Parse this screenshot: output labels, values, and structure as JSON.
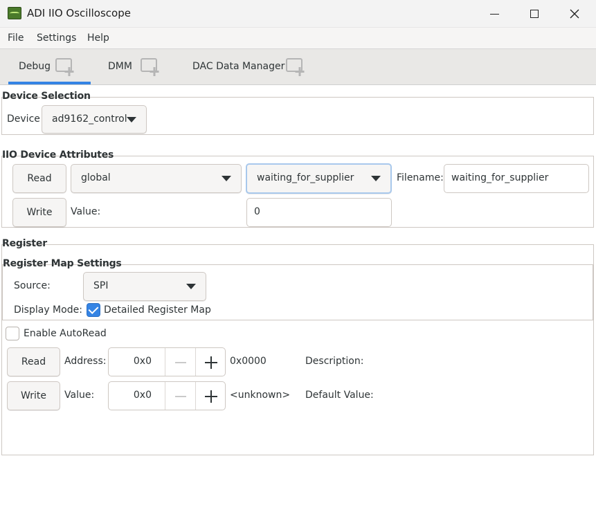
{
  "window": {
    "title": "ADI IIO Oscilloscope"
  },
  "menu": {
    "items": [
      "File",
      "Settings",
      "Help"
    ]
  },
  "tabs": [
    {
      "label": "Debug",
      "active": true
    },
    {
      "label": "DMM",
      "active": false
    },
    {
      "label": "DAC Data Manager",
      "active": false
    }
  ],
  "device_selection": {
    "title": "Device Selection",
    "device_label": "Device",
    "device_value": "ad9162_control"
  },
  "iio_attributes": {
    "title": "IIO Device Attributes",
    "read_label": "Read",
    "write_label": "Write",
    "scope_value": "global",
    "attribute_value": "waiting_for_supplier",
    "filename_label": "Filename:",
    "filename_value": "waiting_for_supplier",
    "value_label": "Value:",
    "value_value": "0"
  },
  "register": {
    "title": "Register",
    "map_settings_title": "Register Map Settings",
    "source_label": "Source:",
    "source_value": "SPI",
    "display_mode_label": "Display Mode:",
    "detailed_map_label": "Detailed Register Map",
    "detailed_map_checked": true,
    "autoread_label": "Enable AutoRead",
    "autoread_checked": false,
    "read_label": "Read",
    "write_label": "Write",
    "address_label": "Address:",
    "address_value": "0x0",
    "address_hex": "0x0000",
    "description_label": "Description:",
    "value_label": "Value:",
    "value_value": "0x0",
    "value_hex": "<unknown>",
    "default_value_label": "Default Value:"
  },
  "colors": {
    "accent": "#3584e4",
    "border": "#cdc7c2"
  }
}
